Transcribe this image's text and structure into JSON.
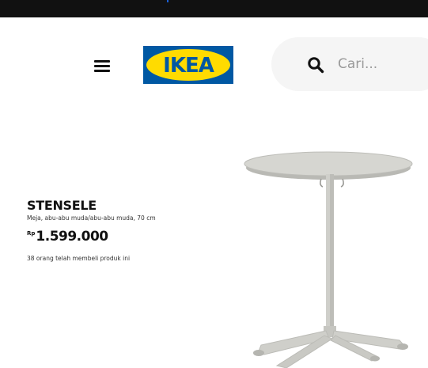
{
  "header": {
    "logo_text": "IKEA",
    "search": {
      "placeholder": "Cari..."
    }
  },
  "product": {
    "name": "STENSELE",
    "description": "Meja, abu-abu muda/abu-abu muda, 70 cm",
    "price": {
      "currency": "Rp",
      "amount": "1.599.000"
    },
    "purchase_count_text": "38 orang telah membeli produk ini"
  },
  "colors": {
    "brand_blue": "#0058a3",
    "brand_yellow": "#ffdb00",
    "topbar": "#111111",
    "search_bg": "#f5f5f5"
  },
  "icons": {
    "menu": "hamburger-icon",
    "search": "search-icon"
  }
}
